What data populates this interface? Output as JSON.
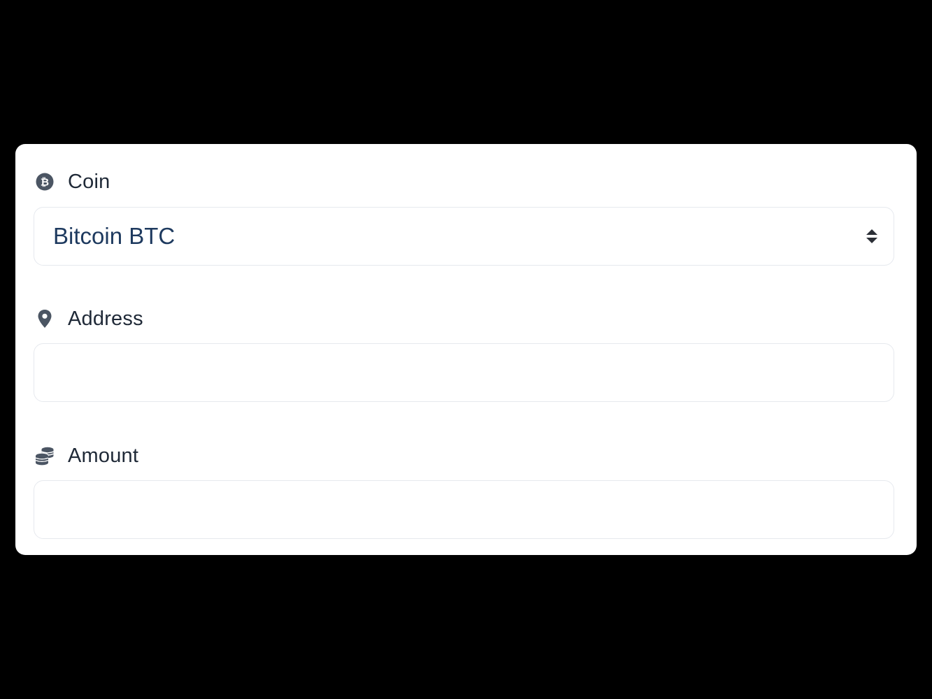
{
  "form": {
    "coin": {
      "label": "Coin",
      "icon": "bitcoin-icon",
      "selected": "Bitcoin BTC"
    },
    "address": {
      "label": "Address",
      "icon": "map-pin-icon",
      "value": "",
      "placeholder": ""
    },
    "amount": {
      "label": "Amount",
      "icon": "coins-icon",
      "value": "",
      "placeholder": ""
    }
  },
  "colors": {
    "background": "#000000",
    "card": "#ffffff",
    "label_text": "#1f2937",
    "value_text": "#1e3a5f",
    "icon": "#4b5563",
    "border": "#e6e9ee"
  }
}
